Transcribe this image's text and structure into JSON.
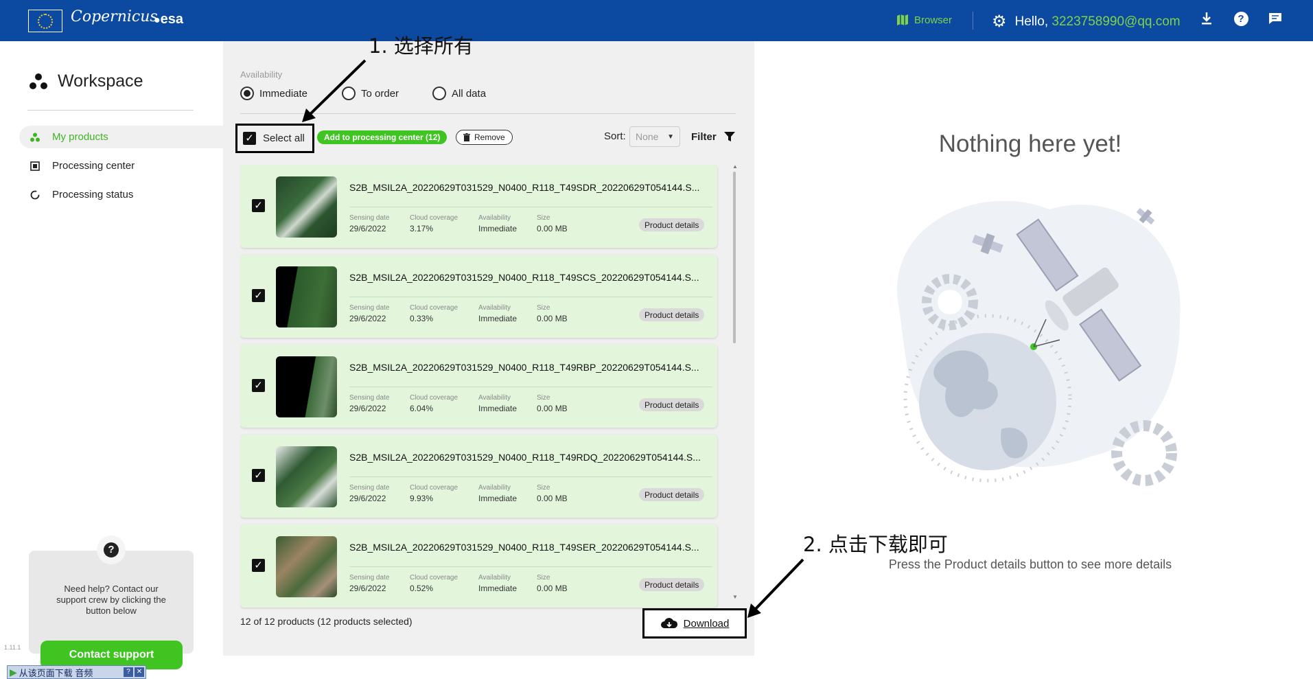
{
  "header": {
    "logos": [
      "eu-flag",
      "Copernicus",
      "esa"
    ],
    "copernicus_text": "Copernicus",
    "esa_text": "esa",
    "browser_label": "Browser",
    "greeting": "Hello,",
    "email": "3223758990@qq.com"
  },
  "sidebar": {
    "title": "Workspace",
    "items": [
      {
        "label": "My products",
        "icon": "products-icon",
        "active": true
      },
      {
        "label": "Processing center",
        "icon": "processing-center-icon",
        "active": false
      },
      {
        "label": "Processing status",
        "icon": "processing-status-icon",
        "active": false
      }
    ],
    "help_text": "Need help? Contact our support crew by clicking the button below",
    "contact_label": "Contact support",
    "download_ext_label": "从该页面下载 音频",
    "version": "1.11.1"
  },
  "main": {
    "availability_label": "Availability",
    "radios": [
      {
        "label": "Immediate",
        "selected": true
      },
      {
        "label": "To order",
        "selected": false
      },
      {
        "label": "All data",
        "selected": false
      }
    ],
    "select_all_label": "Select all",
    "add_label": "Add to processing center (12)",
    "remove_label": "Remove",
    "sort_label": "Sort:",
    "sort_value": "None",
    "filter_label": "Filter",
    "meta_labels": {
      "date": "Sensing date",
      "cloud": "Cloud coverage",
      "avail": "Availability",
      "size": "Size"
    },
    "details_label": "Product details",
    "products": [
      {
        "name": "S2B_MSIL2A_20220629T031529_N0400_R118_T49SDR_20220629T054144.S...",
        "date": "29/6/2022",
        "cloud": "3.17%",
        "availability": "Immediate",
        "size": "0.00 MB",
        "checked": true
      },
      {
        "name": "S2B_MSIL2A_20220629T031529_N0400_R118_T49SCS_20220629T054144.S...",
        "date": "29/6/2022",
        "cloud": "0.33%",
        "availability": "Immediate",
        "size": "0.00 MB",
        "checked": true
      },
      {
        "name": "S2B_MSIL2A_20220629T031529_N0400_R118_T49RBP_20220629T054144.S...",
        "date": "29/6/2022",
        "cloud": "6.04%",
        "availability": "Immediate",
        "size": "0.00 MB",
        "checked": true
      },
      {
        "name": "S2B_MSIL2A_20220629T031529_N0400_R118_T49RDQ_20220629T054144.S...",
        "date": "29/6/2022",
        "cloud": "9.93%",
        "availability": "Immediate",
        "size": "0.00 MB",
        "checked": true
      },
      {
        "name": "S2B_MSIL2A_20220629T031529_N0400_R118_T49SER_20220629T054144.S...",
        "date": "29/6/2022",
        "cloud": "0.52%",
        "availability": "Immediate",
        "size": "0.00 MB",
        "checked": true
      }
    ],
    "count_text": "12 of 12 products (12 products selected)",
    "download_label": "Download"
  },
  "right": {
    "empty_title": "Nothing here yet!",
    "hint": "Press the Product details button to see more details"
  },
  "annotations": {
    "step1": "1. 选择所有",
    "step2": "2. 点击下载即可"
  },
  "colors": {
    "header_bg": "#0b4aa0",
    "accent_green": "#3fc421",
    "card_bg": "#e3f6dc"
  }
}
